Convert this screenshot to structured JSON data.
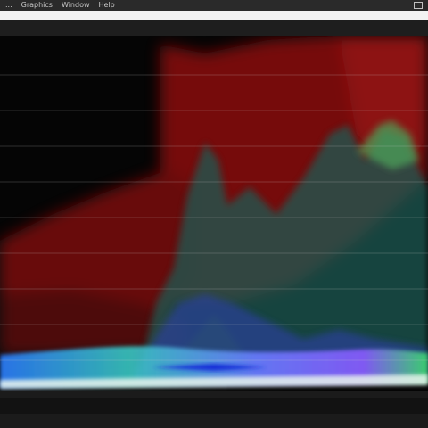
{
  "menubar": {
    "items": [
      "...",
      "Graphics",
      "Window",
      "Help"
    ]
  },
  "scope": {
    "name": "parade waveform scope",
    "graticule_lines": 7
  }
}
